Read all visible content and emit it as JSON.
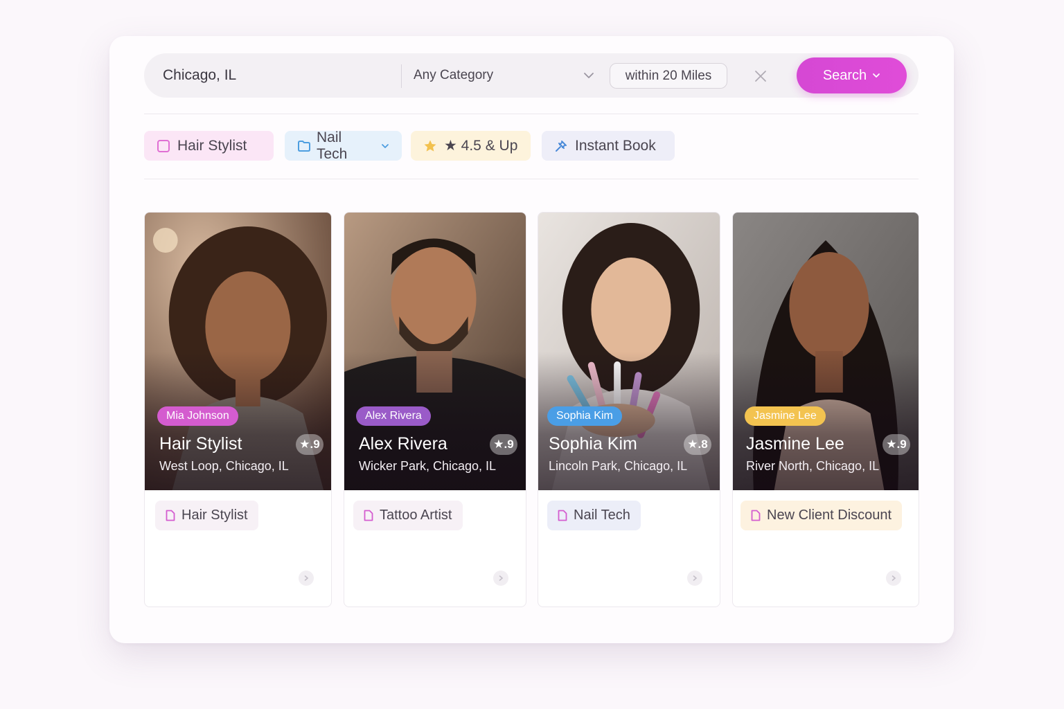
{
  "search": {
    "location_value": "Chicago, IL",
    "category_value": "Any Category",
    "distance_value": "within 20 Miles",
    "search_label": "Search"
  },
  "filters": [
    {
      "label": "Hair Stylist",
      "icon": "square-outline-icon",
      "color": "#e879d6"
    },
    {
      "label": "Nail Tech",
      "icon": "folder-icon",
      "color": "#5aa6e0"
    },
    {
      "label": "★ 4.5 & Up",
      "icon": "star-icon",
      "color": "#f2c14e"
    },
    {
      "label": "Instant Book",
      "icon": "pin-icon",
      "color": "#4a8ad8"
    }
  ],
  "cards": [
    {
      "name_tag": "Mia Johnson",
      "title": "Hair Stylist",
      "rating": "★.9",
      "location": "West Loop, Chicago, IL",
      "service": "Hair Stylist",
      "tag_color": "#d45ccf"
    },
    {
      "name_tag": "Alex Rivera",
      "title": "Alex Rivera",
      "rating": "★.9",
      "location": "Wicker Park, Chicago, IL",
      "service": "Tattoo Artist",
      "tag_color": "#9a5bc8"
    },
    {
      "name_tag": "Sophia Kim",
      "title": "Sophia Kim",
      "rating": "★.8",
      "location": "Lincoln Park, Chicago, IL",
      "service": "Nail Tech",
      "tag_color": "#4a9ee6"
    },
    {
      "name_tag": "Jasmine Lee",
      "title": "Jasmine Lee",
      "rating": "★.9",
      "location": "River North, Chicago, IL",
      "service": "New Client Discount",
      "tag_color": "#f3c350"
    }
  ],
  "colors": {
    "accent": "#d94ad6",
    "chip_pink_bg": "#fbe6f6",
    "chip_blue_bg": "#e6f1fb",
    "chip_yellow_bg": "#fdf3dc",
    "chip_lavender_bg": "#eeeef8"
  }
}
